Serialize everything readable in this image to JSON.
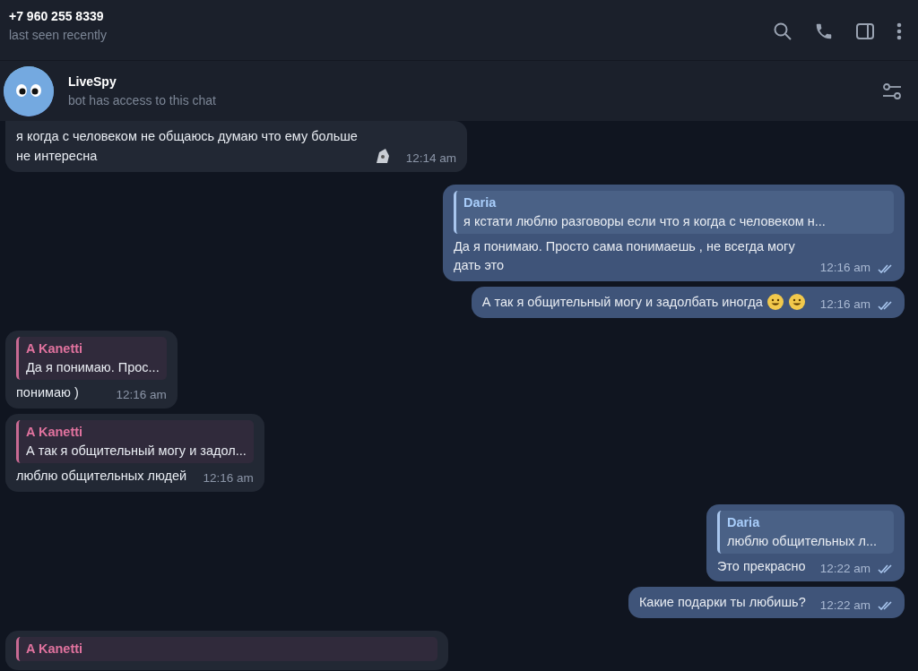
{
  "chat_header": {
    "title": "+7 960 255 8339",
    "status": "last seen recently"
  },
  "bot_bar": {
    "name": "LiveSpy",
    "subtitle": "bot has access to this chat"
  },
  "messages": [
    {
      "kind": "incoming",
      "text": "я когда с человеком не общаюсь думаю что ему больше не интересна",
      "trailing": [
        {
          "kind": "sticker"
        }
      ],
      "time": "12:14 am"
    },
    {
      "kind": "outgoing",
      "reply": {
        "name": "Daria",
        "text": "я кстати люблю разговоры если что  я когда с человеком н..."
      },
      "text": "Да я понимаю. Просто сама понимаешь , не всегда могу дать это",
      "time": "12:16 am",
      "read": true
    },
    {
      "kind": "outgoing",
      "text": "А так я общительный могу и задолбать иногда",
      "trailing": [
        {
          "kind": "emoji"
        },
        {
          "kind": "emoji"
        }
      ],
      "time": "12:16 am",
      "read": true
    },
    {
      "kind": "incoming",
      "reply": {
        "name": "A Kanetti",
        "text": "Да я понимаю. Прос..."
      },
      "text": "понимаю )",
      "time": "12:16 am"
    },
    {
      "kind": "incoming",
      "reply": {
        "name": "A Kanetti",
        "text": "А так я общительный могу и задол..."
      },
      "text": "люблю общительных людей",
      "time": "12:16 am"
    },
    {
      "kind": "outgoing",
      "reply": {
        "name": "Daria",
        "text": "люблю общительных л..."
      },
      "text": "Это прекрасно",
      "time": "12:22 am",
      "read": true
    },
    {
      "kind": "outgoing",
      "text": "Какие подарки ты любишь?",
      "time": "12:22 am",
      "read": true
    },
    {
      "kind": "incoming",
      "reply": {
        "name": "A Kanetti"
      }
    }
  ]
}
